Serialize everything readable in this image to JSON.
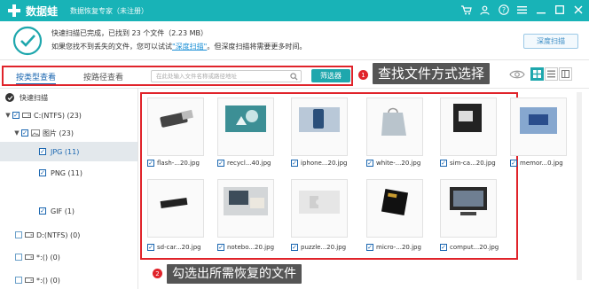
{
  "titlebar": {
    "app_name": "数据蛙",
    "subtitle": "数据恢复专家（未注册）",
    "bg": "#18b3b7"
  },
  "info": {
    "line1": "快速扫描已完成，已找到 23 个文件（2.23 MB）",
    "line2_pre": "如果您找不到丢失的文件，您可以试试",
    "line2_link": "\"深度扫描\"",
    "line2_post": "。但深度扫描将需要更多时间。",
    "deep_scan_button": "深度扫描"
  },
  "toolbar": {
    "tab_type": "按类型查看",
    "tab_path": "按路径查看",
    "search_placeholder": "在此处输入文件名称或路径地址",
    "filter_button": "筛选器",
    "badge1": "1",
    "callout1": "查找文件方式选择"
  },
  "sidebar": {
    "rows": [
      {
        "label": "快速扫描"
      },
      {
        "label": "C:(NTFS) (23)"
      },
      {
        "label": "图片 (23)"
      },
      {
        "label": "JPG (11)"
      },
      {
        "label": "PNG (11)"
      },
      {
        "label": "GIF (1)"
      },
      {
        "label": "D:(NTFS) (0)"
      },
      {
        "label": "*:() (0)"
      },
      {
        "label": "*:() (0)"
      }
    ]
  },
  "files": [
    {
      "name": "flash-...20.jpg",
      "icon": "usb-flash-drive-icon"
    },
    {
      "name": "recycl...40.jpg",
      "icon": "recycle-bin-icon"
    },
    {
      "name": "iphone...20.jpg",
      "icon": "phone-in-hand-icon"
    },
    {
      "name": "white-...20.jpg",
      "icon": "bag-icon"
    },
    {
      "name": "sim-ca...20.jpg",
      "icon": "sim-card-icon"
    },
    {
      "name": "memor...0.jpg",
      "icon": "memory-card-icon"
    },
    {
      "name": "sd-car...20.jpg",
      "icon": "sd-card-icon"
    },
    {
      "name": "notebo...20.jpg",
      "icon": "notebook-icon"
    },
    {
      "name": "puzzle...20.jpg",
      "icon": "puzzle-icon"
    },
    {
      "name": "micro-...20.jpg",
      "icon": "micro-sd-icon"
    },
    {
      "name": "comput...20.jpg",
      "icon": "computer-icon"
    }
  ],
  "bottom": {
    "badge2": "2",
    "callout2": "勾选出所需恢复的文件"
  },
  "colors": {
    "accent": "#18b3b7",
    "highlight": "#e0232a",
    "callout_bg": "#555555"
  }
}
